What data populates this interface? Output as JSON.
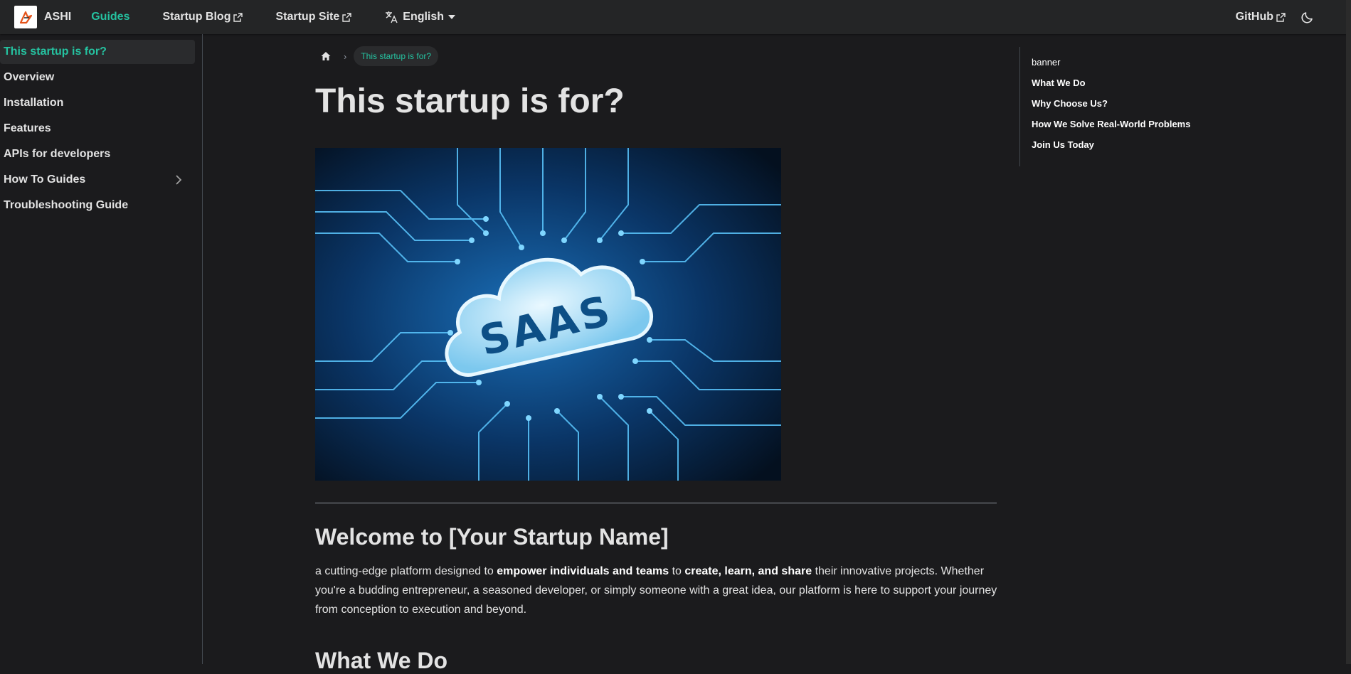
{
  "navbar": {
    "brand": "ASHI",
    "items": [
      {
        "label": "Guides",
        "active": true
      },
      {
        "label": "Startup Blog",
        "external": true
      },
      {
        "label": "Startup Site",
        "external": true
      }
    ],
    "language": "English",
    "github": "GitHub",
    "theme_icon": "moon-icon"
  },
  "sidebar": {
    "items": [
      {
        "label": "This startup is for?",
        "active": true
      },
      {
        "label": "Overview"
      },
      {
        "label": "Installation"
      },
      {
        "label": "Features"
      },
      {
        "label": "APIs for developers"
      },
      {
        "label": "How To Guides",
        "expandable": true
      },
      {
        "label": "Troubleshooting Guide"
      }
    ]
  },
  "breadcrumb": {
    "home_icon": "home-icon",
    "current": "This startup is for?"
  },
  "main": {
    "title": "This startup is for?",
    "banner_text": "SAAS",
    "welcome_heading": "Welcome to [Your Startup Name]",
    "para": {
      "t1": "a cutting-edge platform designed to ",
      "b1": "empower individuals and teams",
      "t2": " to ",
      "b2": "create, learn, and share",
      "t3": " their innovative projects. Whether you're a budding entrepreneur, a seasoned developer, or simply someone with a great idea, our platform is here to support your journey from conception to execution and beyond."
    },
    "next_heading": "What We Do"
  },
  "toc": {
    "items": [
      {
        "label": "banner",
        "bold": false
      },
      {
        "label": "What We Do",
        "bold": true
      },
      {
        "label": "Why Choose Us?",
        "bold": true
      },
      {
        "label": "How We Solve Real-World Problems",
        "bold": true
      },
      {
        "label": "Join Us Today",
        "bold": true
      }
    ]
  },
  "colors": {
    "accent": "#25c2a0",
    "background": "#1b1b1d",
    "navbar": "#242526"
  }
}
